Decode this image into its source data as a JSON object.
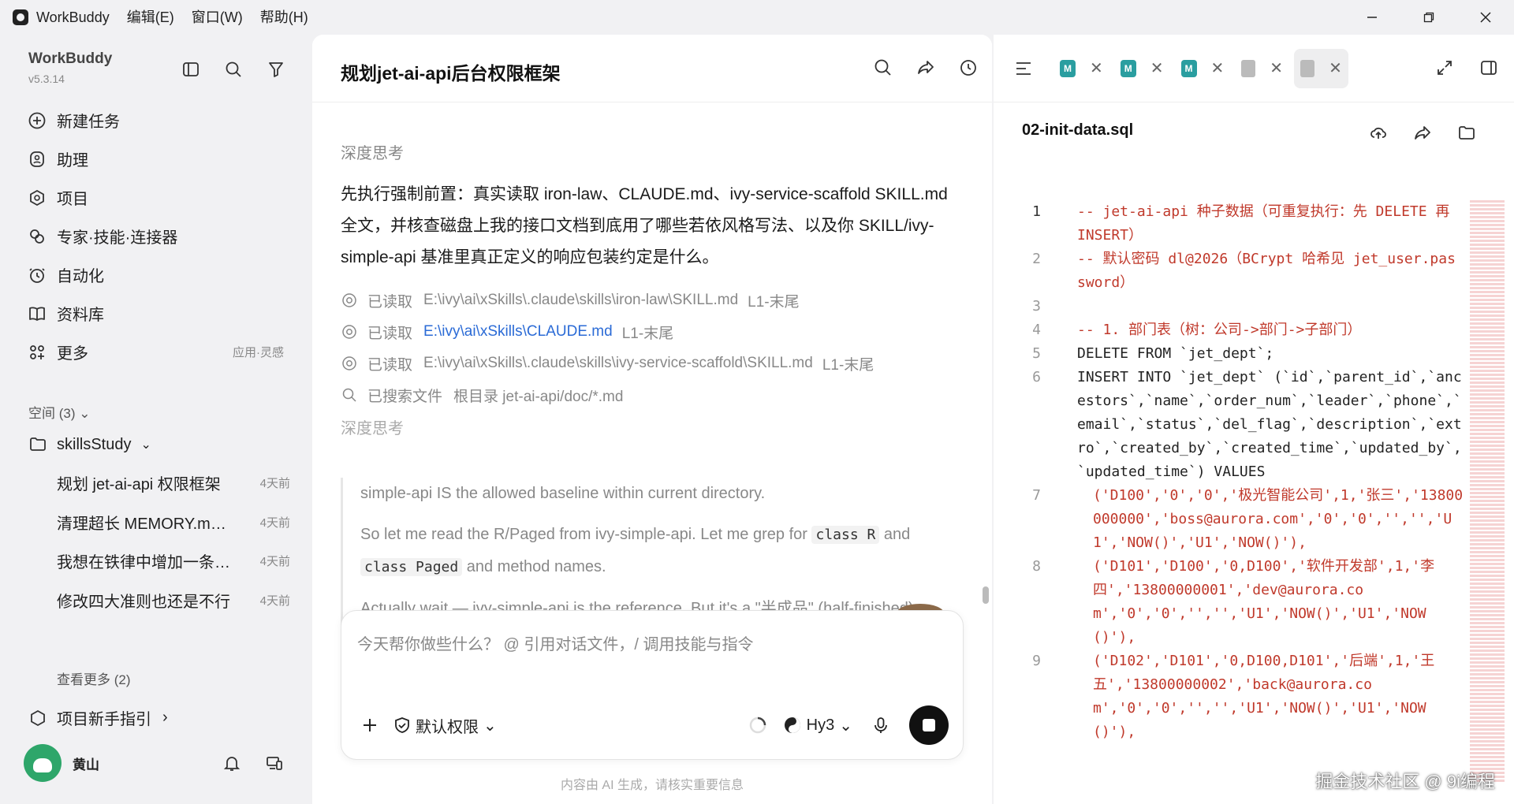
{
  "titlebar": {
    "app_name": "WorkBuddy",
    "menus": [
      "编辑(E)",
      "窗口(W)",
      "帮助(H)"
    ]
  },
  "sidebar": {
    "brand_name": "WorkBuddy",
    "version": "v5.3.14",
    "nav": [
      {
        "label": "新建任务",
        "icon": "new-task-icon"
      },
      {
        "label": "助理",
        "icon": "assistant-icon"
      },
      {
        "label": "项目",
        "icon": "project-icon"
      },
      {
        "label": "专家·技能·连接器",
        "icon": "experts-icon"
      },
      {
        "label": "自动化",
        "icon": "automation-icon"
      },
      {
        "label": "资料库",
        "icon": "library-icon"
      },
      {
        "label": "更多",
        "icon": "more-icon",
        "extra": "应用·灵感"
      }
    ],
    "spaces_title": "空间 (3)",
    "space_name": "skillsStudy",
    "tasks": [
      {
        "title": "规划 jet-ai-api 权限框架",
        "time": "4天前"
      },
      {
        "title": "清理超长 MEMORY.md 文件",
        "time": "4天前"
      },
      {
        "title": "我想在铁律中增加一条规则",
        "time": "4天前"
      },
      {
        "title": "修改四大准则也还是不行",
        "time": "4天前"
      }
    ],
    "see_more": "查看更多 (2)",
    "guide": "项目新手指引",
    "user_name": "黄山"
  },
  "chat": {
    "title": "规划jet-ai-api后台权限框架",
    "deep_think_1": "深度思考",
    "intro": "先执行强制前置：真实读取 iron-law、CLAUDE.md、ivy-service-scaffold SKILL.md 全文，并核查磁盘上我的接口文档到底用了哪些若依风格写法、以及你 SKILL/ivy-simple-api 基准里真正定义的响应包装约定是什么。",
    "tools": [
      {
        "verb": "已读取",
        "path": "E:\\ivy\\ai\\xSkills\\.claude\\skills\\iron-law\\SKILL.md",
        "range": "L1-末尾",
        "link": false,
        "icon": "eye-icon"
      },
      {
        "verb": "已读取",
        "path": "E:\\ivy\\ai\\xSkills\\CLAUDE.md",
        "range": "L1-末尾",
        "link": true,
        "icon": "eye-icon"
      },
      {
        "verb": "已读取",
        "path": "E:\\ivy\\ai\\xSkills\\.claude\\skills\\ivy-service-scaffold\\SKILL.md",
        "range": "L1-末尾",
        "link": false,
        "icon": "eye-icon"
      },
      {
        "verb": "已搜索文件",
        "path": "根目录  jet-ai-api/doc/*.md",
        "range": "",
        "link": false,
        "icon": "search-icon"
      }
    ],
    "deep_think_2": "深度思考",
    "think_1": "simple-api IS the allowed baseline within current directory.",
    "think_2_a": "So let me read the R/Paged from ivy-simple-api. Let me grep for",
    "think_2_code1": "class R",
    "think_2_b": "and",
    "think_2_code2": "class Paged",
    "think_2_c": "and method names.",
    "think_3": "Actually wait — ivy-simple-api is the reference. But it's a \"半成品\" (half-finished). The user said where it's incomplete, use RuoYi/jeecg",
    "input_placeholder": "今天帮你做些什么？ @ 引用对话文件，/ 调用技能与指令",
    "permission": "默认权限",
    "model": "Hy3",
    "disclaimer": "内容由 AI 生成，请核实重要信息"
  },
  "editor": {
    "file_name": "02-init-data.sql",
    "lines": [
      {
        "n": "1",
        "text": "-- jet-ai-api 种子数据（可重复执行：先 DELETE 再 INSERT）",
        "kind": "comment",
        "indent": false
      },
      {
        "n": "2",
        "text": "-- 默认密码 dl@2026（BCrypt 哈希见 jet_user.password）",
        "kind": "comment",
        "indent": false
      },
      {
        "n": "3",
        "text": "",
        "kind": "plain",
        "indent": false
      },
      {
        "n": "4",
        "text": "-- 1. 部门表（树：公司->部门->子部门）",
        "kind": "comment",
        "indent": false
      },
      {
        "n": "5",
        "text": "DELETE FROM `jet_dept`;",
        "kind": "plain",
        "indent": false
      },
      {
        "n": "6",
        "text": "INSERT INTO `jet_dept` (`id`,`parent_id`,`ancestors`,`name`,`order_num`,`leader`,`phone`,`email`,`status`,`del_flag`,`description`,`extro`,`created_by`,`created_time`,`updated_by`,`updated_time`) VALUES",
        "kind": "plain",
        "indent": false
      },
      {
        "n": "7",
        "text": "('D100','0','0','极光智能公司',1,'张三','13800000000','boss@aurora.com','0','0','','','U1','NOW()','U1','NOW()'),",
        "kind": "str",
        "indent": true
      },
      {
        "n": "8",
        "text": "('D101','D100','0,D100','软件开发部',1,'李四','13800000001','dev@aurora.com','0','0','','','U1','NOW()','U1','NOW()'),",
        "kind": "str",
        "indent": true
      },
      {
        "n": "9",
        "text": "('D102','D101','0,D100,D101','后端',1,'王五','13800000002','back@aurora.com','0','0','','','U1','NOW()','U1','NOW()'),",
        "kind": "str",
        "indent": true
      }
    ]
  },
  "watermark": "掘金技术社区 @ 9i编程"
}
